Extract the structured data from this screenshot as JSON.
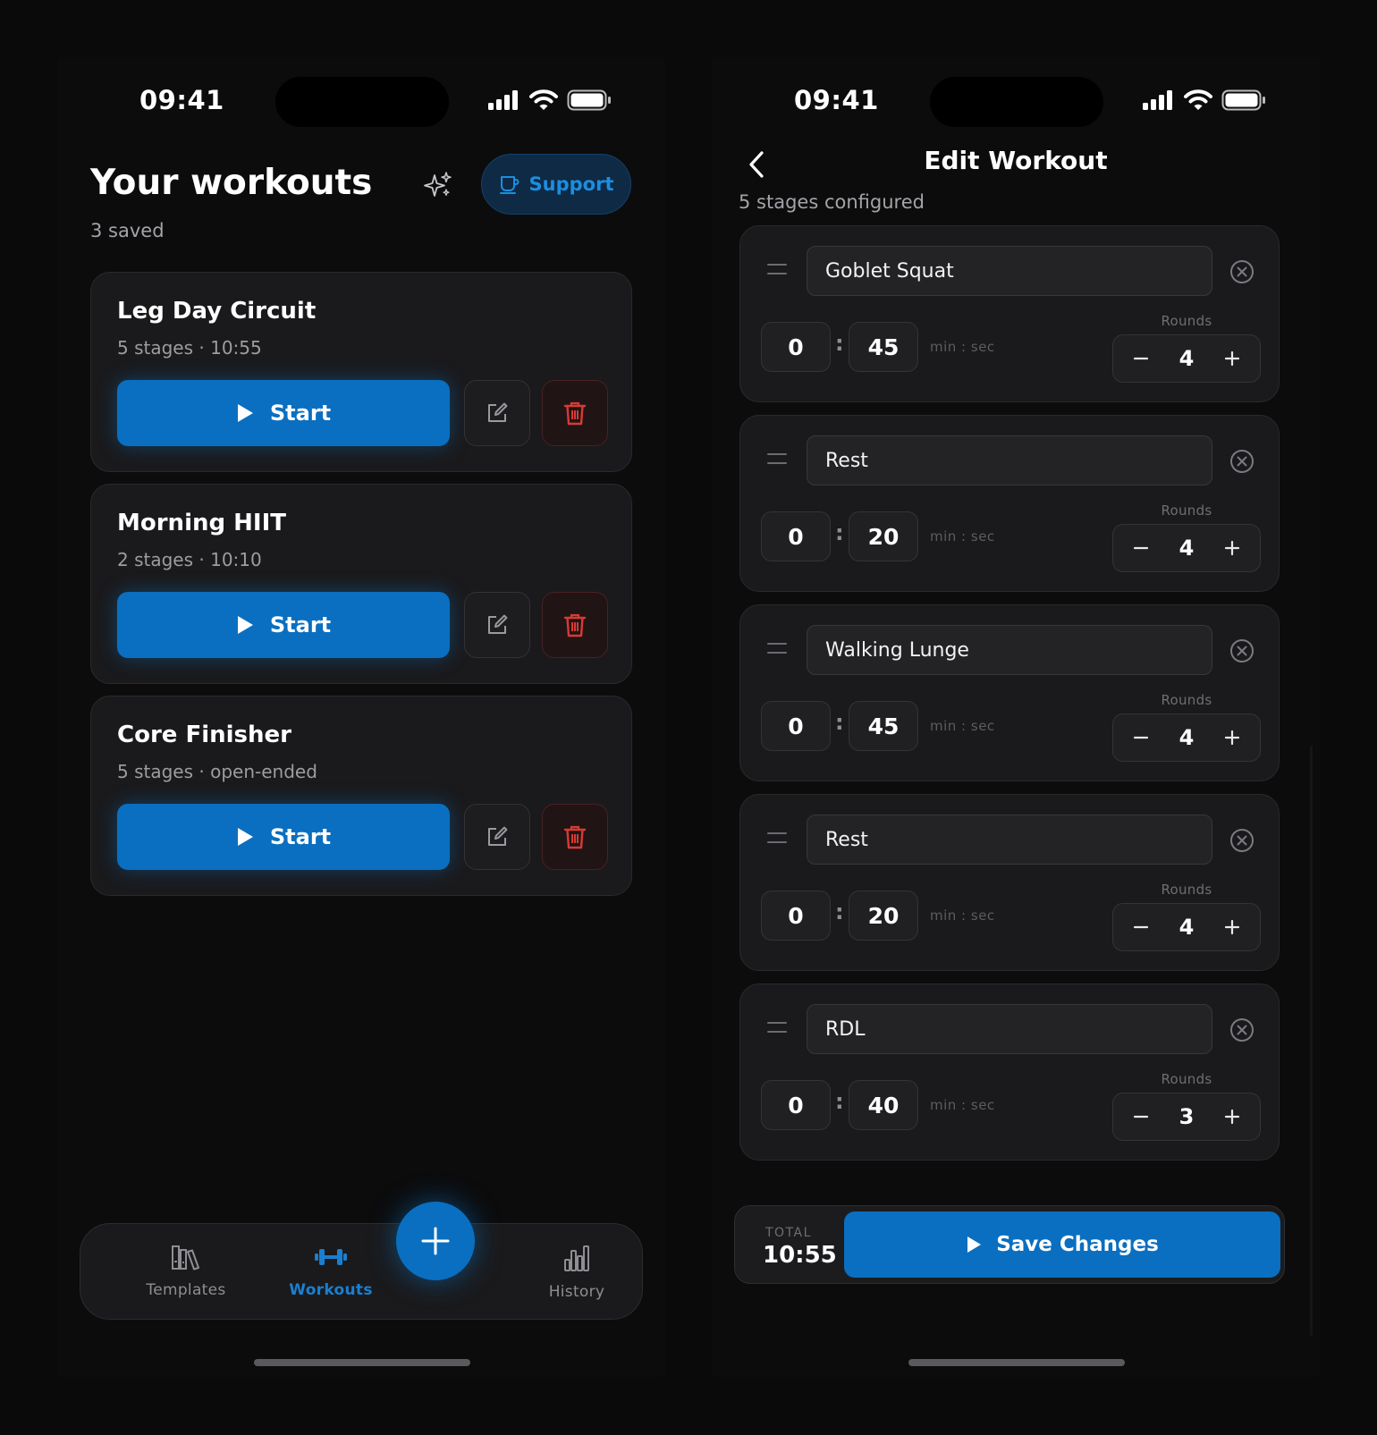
{
  "colors": {
    "accent": "#0a6fc0",
    "danger": "#d93a33",
    "background": "#0c0c0d",
    "card": "#1a1a1c"
  },
  "status_bar": {
    "time": "09:41",
    "icons": [
      "cellular-signal-icon",
      "wifi-icon",
      "battery-icon"
    ]
  },
  "workouts_screen": {
    "title": "Your workouts",
    "saved_count": "3 saved",
    "support_label": "Support",
    "icons": [
      "sparkles-icon",
      "coffee-cup-icon"
    ],
    "workouts": [
      {
        "name": "Leg Day Circuit",
        "meta": "5 stages · 10:55",
        "start_label": "Start"
      },
      {
        "name": "Morning HIIT",
        "meta": "2 stages · 10:10",
        "start_label": "Start"
      },
      {
        "name": "Core Finisher",
        "meta": "5 stages · open-ended",
        "start_label": "Start"
      }
    ],
    "tabs": [
      {
        "label": "Templates",
        "icon": "books-icon",
        "active": false
      },
      {
        "label": "Workouts",
        "icon": "dumbbell-icon",
        "active": true
      },
      {
        "label": "History",
        "icon": "bar-chart-icon",
        "active": false
      }
    ]
  },
  "edit_screen": {
    "title": "Edit Workout",
    "stages_count": "5 stages configured",
    "time_unit_label": "min : sec",
    "rounds_label": "Rounds",
    "stages": [
      {
        "name": "Goblet Squat",
        "min": "0",
        "sec": "45",
        "rounds": "4"
      },
      {
        "name": "Rest",
        "min": "0",
        "sec": "20",
        "rounds": "4"
      },
      {
        "name": "Walking Lunge",
        "min": "0",
        "sec": "45",
        "rounds": "4"
      },
      {
        "name": "Rest",
        "min": "0",
        "sec": "20",
        "rounds": "4"
      },
      {
        "name": "RDL",
        "min": "0",
        "sec": "40",
        "rounds": "3"
      }
    ],
    "total_label": "TOTAL",
    "total_value": "10:55",
    "save_label": "Save Changes"
  }
}
